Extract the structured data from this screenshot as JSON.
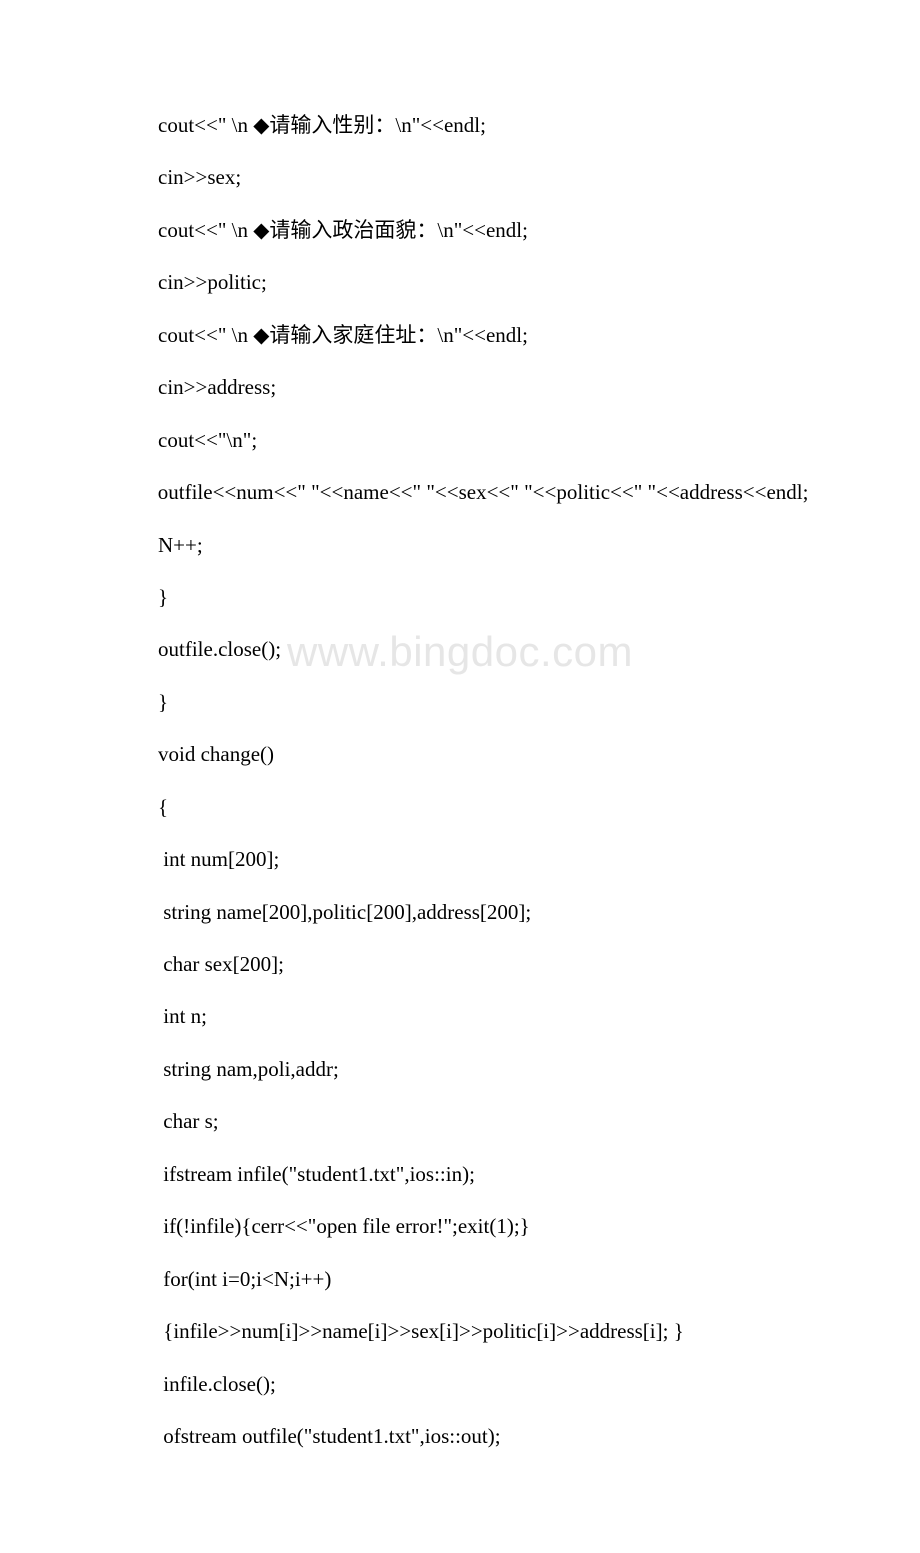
{
  "watermark": "www.bingdoc.com",
  "lines": [
    {
      "indent": true,
      "text": "cout<<\" \\n ◆请输入性别：\\n\"<<endl;"
    },
    {
      "indent": true,
      "text": "cin>>sex;"
    },
    {
      "indent": true,
      "text": "cout<<\" \\n ◆请输入政治面貌：\\n\"<<endl;"
    },
    {
      "indent": true,
      "text": "cin>>politic;"
    },
    {
      "indent": true,
      "text": "cout<<\" \\n ◆请输入家庭住址：\\n\"<<endl;"
    },
    {
      "indent": true,
      "text": "cin>>address;"
    },
    {
      "indent": true,
      "text": "cout<<\"\\n\";"
    },
    {
      "indent": false,
      "text": "           outfile<<num<<\" \"<<name<<\" \"<<sex<<\" \"<<politic<<\" \"<<address<<endl;"
    },
    {
      "indent": true,
      "text": "N++;"
    },
    {
      "indent": true,
      "text": "}"
    },
    {
      "indent": true,
      "text": "outfile.close();"
    },
    {
      "indent": true,
      "text": "}"
    },
    {
      "indent": true,
      "text": "void change()"
    },
    {
      "indent": true,
      "text": "{"
    },
    {
      "indent": true,
      "text": " int num[200];"
    },
    {
      "indent": true,
      "text": " string name[200],politic[200],address[200];"
    },
    {
      "indent": true,
      "text": " char sex[200];"
    },
    {
      "indent": true,
      "text": " int n;"
    },
    {
      "indent": true,
      "text": " string nam,poli,addr;"
    },
    {
      "indent": true,
      "text": " char s;"
    },
    {
      "indent": true,
      "text": " ifstream infile(\"student1.txt\",ios::in);"
    },
    {
      "indent": true,
      "text": " if(!infile){cerr<<\"open file error!\";exit(1);}"
    },
    {
      "indent": true,
      "text": " for(int i=0;i<N;i++)"
    },
    {
      "indent": true,
      "text": " {infile>>num[i]>>name[i]>>sex[i]>>politic[i]>>address[i]; }"
    },
    {
      "indent": true,
      "text": " infile.close();"
    },
    {
      "indent": true,
      "text": " ofstream outfile(\"student1.txt\",ios::out);"
    }
  ]
}
